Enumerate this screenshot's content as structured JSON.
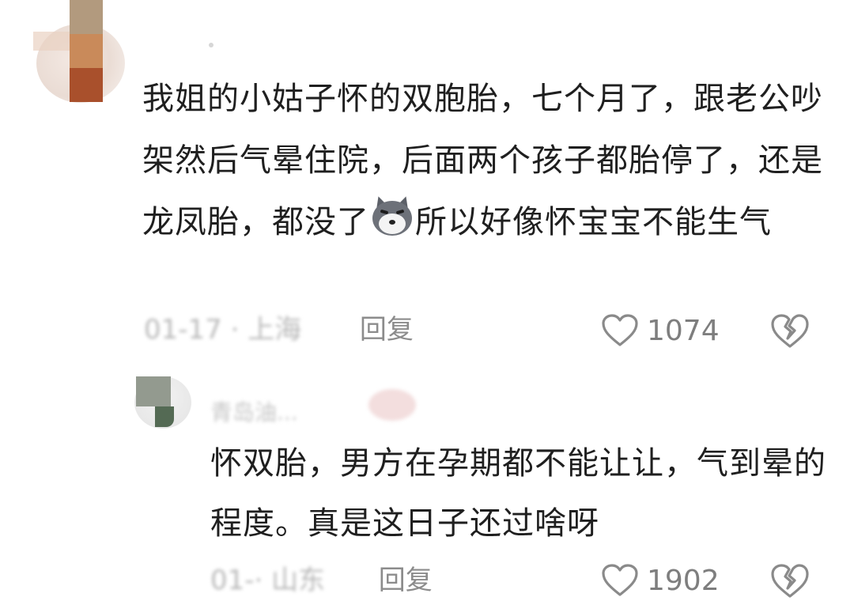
{
  "comment1": {
    "username": "·",
    "text_before_emoji": "我姐的小姑子怀的双胞胎，七个月了，跟老公吵架然后气晕住院，后面两个孩子都胎停了，还是龙凤胎，都没了",
    "emoji_icon": "husky-dog-emoji-icon",
    "text_after_emoji": "所以好像怀宝宝不能生气",
    "date_location": "01-17 · 上海",
    "reply_label": "回复",
    "like_count": "1074"
  },
  "comment2": {
    "username": "青岛油...",
    "text": "怀双胎，男方在孕期都不能让让，气到晕的程度。真是这日子还过啥呀",
    "date_location": "01-· 山东",
    "reply_label": "回复",
    "like_count": "1902"
  },
  "icons": {
    "like": "heart-outline-icon",
    "dislike": "broken-heart-icon"
  },
  "colors": {
    "text": "#1f1f1f",
    "meta": "#a8a8a8",
    "icon": "#8a8a8a"
  }
}
